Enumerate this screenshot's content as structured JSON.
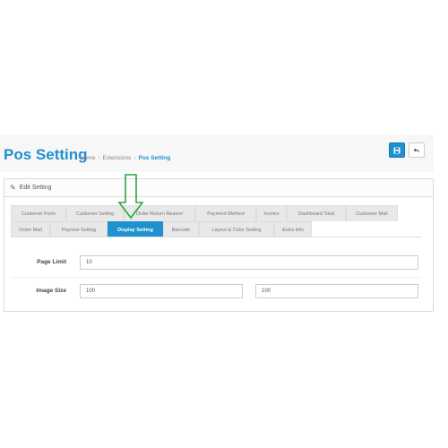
{
  "page": {
    "title": "Pos Setting"
  },
  "breadcrumb": {
    "home": "Home",
    "extensions": "Extensions",
    "current": "Pos Setting"
  },
  "actions": {
    "save_icon": "floppy-disk-icon",
    "back_icon": "reply-icon",
    "accent_color": "#1e91cf"
  },
  "panel": {
    "heading_icon": "pencil-icon",
    "heading": "Edit Setting"
  },
  "tabs": [
    {
      "label": "Customer Form",
      "active": false
    },
    {
      "label": "Customer Setting",
      "active": false
    },
    {
      "label": "Order Return Reason",
      "active": false
    },
    {
      "label": "Payment Method",
      "active": false
    },
    {
      "label": "Invoice",
      "active": false
    },
    {
      "label": "Dashboard Total",
      "active": false
    },
    {
      "label": "Customer Mail",
      "active": false
    },
    {
      "label": "Order Mail",
      "active": false
    },
    {
      "label": "Paynow Setting",
      "active": false
    },
    {
      "label": "Display Setting",
      "active": true
    },
    {
      "label": "Barcode",
      "active": false
    },
    {
      "label": "Layout & Color Setting",
      "active": false
    },
    {
      "label": "Extra Info",
      "active": false
    }
  ],
  "form": {
    "page_limit": {
      "label": "Page Limit",
      "value": "10"
    },
    "image_size": {
      "label": "Image Size",
      "width": "100",
      "height": "100"
    }
  },
  "annotation": {
    "arrow_color": "#2aa845"
  }
}
